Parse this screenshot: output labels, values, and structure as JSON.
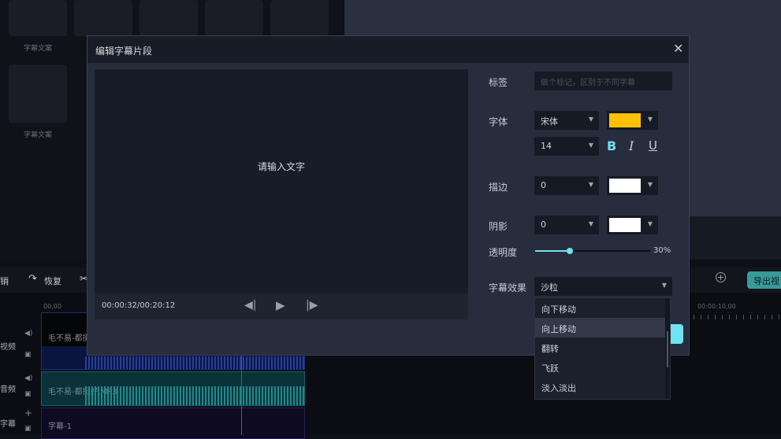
{
  "assets": {
    "items": [
      {
        "label": "字幕文案"
      },
      {
        "label": "字幕文案"
      }
    ]
  },
  "toolbar": {
    "undo_label": "销",
    "redo_label": "恢复",
    "export_label": "导出视"
  },
  "timeline": {
    "ruler_start": "00,00",
    "ruler_mark": "00:00:10,00",
    "tracks": [
      {
        "label": "视频",
        "clip": "毛不易-都挺"
      },
      {
        "label": "音频",
        "clip": "毛不易-都挺好.MP3"
      },
      {
        "label": "字幕",
        "clip": "字幕-1"
      }
    ]
  },
  "dialog": {
    "title": "编辑字幕片段",
    "preview_text": "请输入文字",
    "time": "00:00:32/00:20:12",
    "tag_label": "标签",
    "tag_placeholder": "做个标记，区别于不同字幕",
    "font_label": "字体",
    "font_value": "宋体",
    "font_color": "#ffc107",
    "size_value": "14",
    "bold": "B",
    "italic": "I",
    "underline": "U",
    "stroke_label": "描边",
    "stroke_value": "0",
    "stroke_color": "#ffffff",
    "shadow_label": "阴影",
    "shadow_value": "0",
    "shadow_color": "#ffffff",
    "opacity_label": "透明度",
    "opacity_value": "30%",
    "opacity_fraction": 0.3,
    "effect_label": "字幕效果",
    "effect_value": "沙粒",
    "effect_options": [
      "向下移动",
      "向上移动",
      "翻转",
      "飞跃",
      "淡入淡出"
    ]
  }
}
